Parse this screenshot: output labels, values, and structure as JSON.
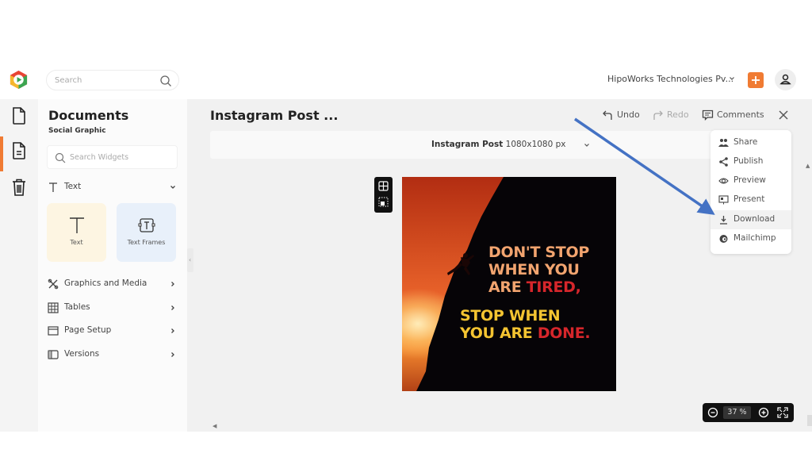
{
  "topbar": {
    "search_placeholder": "Search",
    "organization": "HipoWorks Technologies Pv...",
    "add_button_label": "+",
    "brand_color": "#f07b33"
  },
  "rail": {
    "items": [
      {
        "name": "documents",
        "icon": "file-icon",
        "active": false
      },
      {
        "name": "document-text",
        "icon": "file-text-icon",
        "active": true
      },
      {
        "name": "trash",
        "icon": "trash-icon",
        "active": false
      }
    ]
  },
  "panel": {
    "title": "Documents",
    "subtitle": "Social Graphic",
    "search_placeholder": "Search Widgets",
    "text_section": {
      "label": "Text",
      "expanded": true
    },
    "tiles": [
      {
        "label": "Text",
        "icon": "text-icon"
      },
      {
        "label": "Text Frames",
        "icon": "text-frame-icon"
      }
    ],
    "sections": [
      {
        "label": "Graphics and Media",
        "icon": "graphics-icon"
      },
      {
        "label": "Tables",
        "icon": "table-icon"
      },
      {
        "label": "Page Setup",
        "icon": "page-setup-icon"
      },
      {
        "label": "Versions",
        "icon": "versions-icon"
      }
    ]
  },
  "editor": {
    "doc_title": "Instagram Post ...",
    "undo_label": "Undo",
    "redo_label": "Redo",
    "comments_label": "Comments",
    "format_name": "Instagram Post",
    "format_size": "1080x1080 px",
    "zoom_value": "37",
    "zoom_unit": "%"
  },
  "artboard": {
    "line1": "DON'T STOP",
    "line2": "WHEN YOU",
    "line3_a": "ARE ",
    "line3_b": "TIRED,",
    "line4": "STOP WHEN",
    "line5_a": "YOU ARE ",
    "line5_b": "DONE."
  },
  "menu": {
    "items": [
      {
        "label": "Share",
        "icon": "share-icon"
      },
      {
        "label": "Publish",
        "icon": "publish-icon"
      },
      {
        "label": "Preview",
        "icon": "eye-icon"
      },
      {
        "label": "Present",
        "icon": "present-icon"
      },
      {
        "label": "Download",
        "icon": "download-icon",
        "highlighted": true
      },
      {
        "label": "Mailchimp",
        "icon": "mailchimp-icon"
      }
    ]
  },
  "annotation": {
    "color": "#4472c4",
    "points_to": "Download"
  }
}
